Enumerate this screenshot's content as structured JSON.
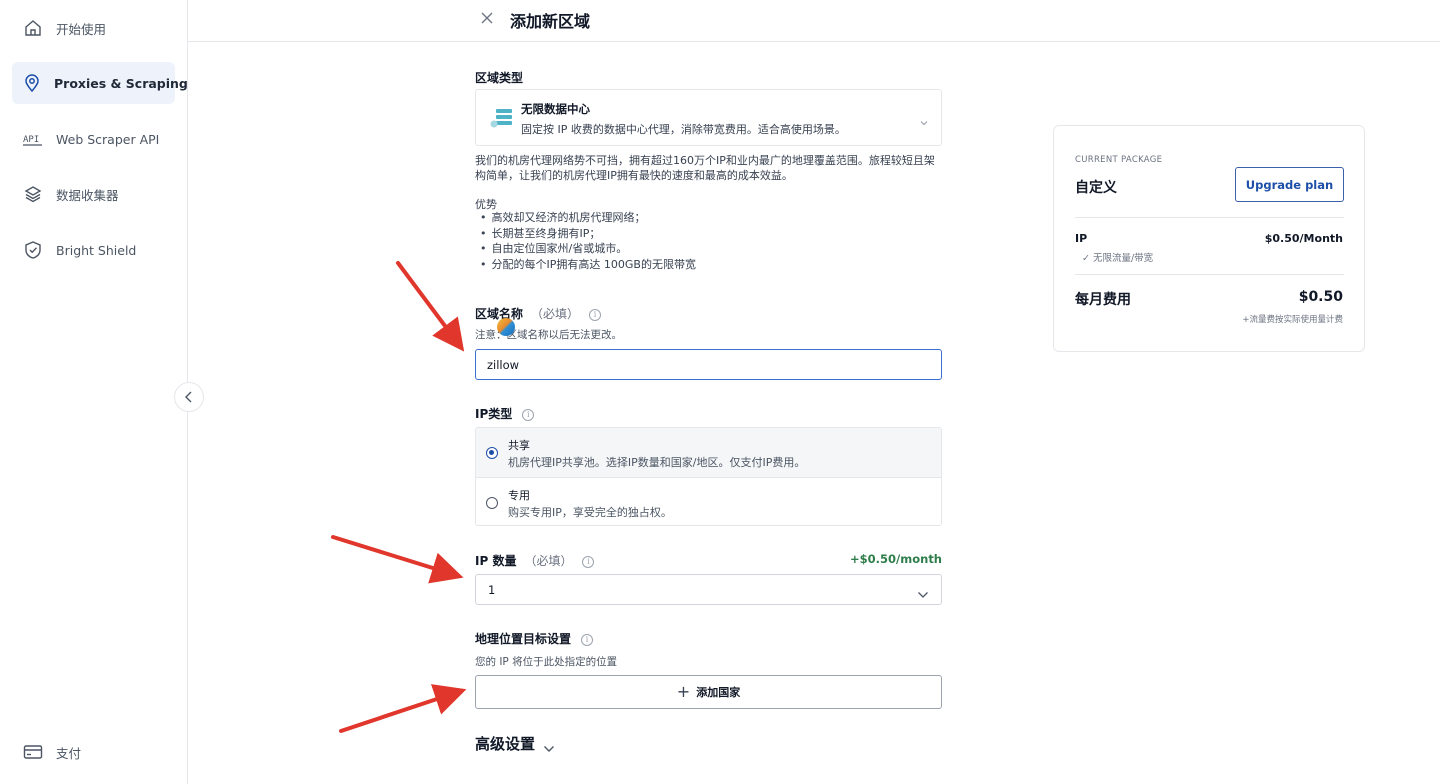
{
  "sidebar": {
    "items": [
      {
        "label": "开始使用",
        "icon": "home-icon"
      },
      {
        "label": "Proxies & Scraping",
        "icon": "location-pin-icon",
        "active": true
      },
      {
        "label": "Web Scraper API",
        "icon": "api-icon"
      },
      {
        "label": "数据收集器",
        "icon": "layers-icon"
      },
      {
        "label": "Bright Shield",
        "icon": "shield-icon"
      }
    ],
    "footer": {
      "label": "支付",
      "icon": "card-icon"
    }
  },
  "header": {
    "title": "添加新区域"
  },
  "zone_type": {
    "label": "区域类型",
    "selected_title": "无限数据中心",
    "selected_desc": "固定按 IP 收费的数据中心代理，消除带宽费用。适合高使用场景。",
    "description": "我们的机房代理网络势不可挡，拥有超过160万个IP和业内最广的地理覆盖范围。旅程较短且架构简单，让我们的机房代理IP拥有最快的速度和最高的成本效益。",
    "advantages_title": "优势",
    "advantages": [
      "高效却又经济的机房代理网络；",
      "长期甚至终身拥有IP；",
      "自由定位国家州/省或城市。",
      "分配的每个IP拥有高达 100GB的无限带宽"
    ]
  },
  "zone_name": {
    "label": "区域名称",
    "required": "（必填）",
    "note": "注意：区域名称以后无法更改。",
    "value": "zillow"
  },
  "ip_type": {
    "label": "IP类型",
    "options": [
      {
        "title": "共享",
        "desc": "机房代理IP共享池。选择IP数量和国家/地区。仅支付IP费用。",
        "selected": true
      },
      {
        "title": "专用",
        "desc": "购买专用IP，享受完全的独占权。",
        "selected": false
      }
    ]
  },
  "ip_count": {
    "label": "IP 数量",
    "required": "（必填）",
    "price": "+$0.50/month",
    "value": "1"
  },
  "geo": {
    "label": "地理位置目标设置",
    "subtitle": "您的 IP 将位于此处指定的位置",
    "add_button": "添加国家"
  },
  "advanced": {
    "label": "高级设置"
  },
  "package": {
    "caption": "CURRENT PACKAGE",
    "name": "自定义",
    "upgrade_button": "Upgrade plan",
    "ip_label": "IP",
    "ip_price": "$0.50/Month",
    "ip_sub": "✓ 无限流量/带宽",
    "monthly_label": "每月费用",
    "monthly_price": "$0.50",
    "monthly_sub": "+流量费按实际使用量计费"
  },
  "colors": {
    "accent": "#1e4fa8",
    "price_green": "#2f7d4a",
    "annotation_red": "#e0362b"
  }
}
